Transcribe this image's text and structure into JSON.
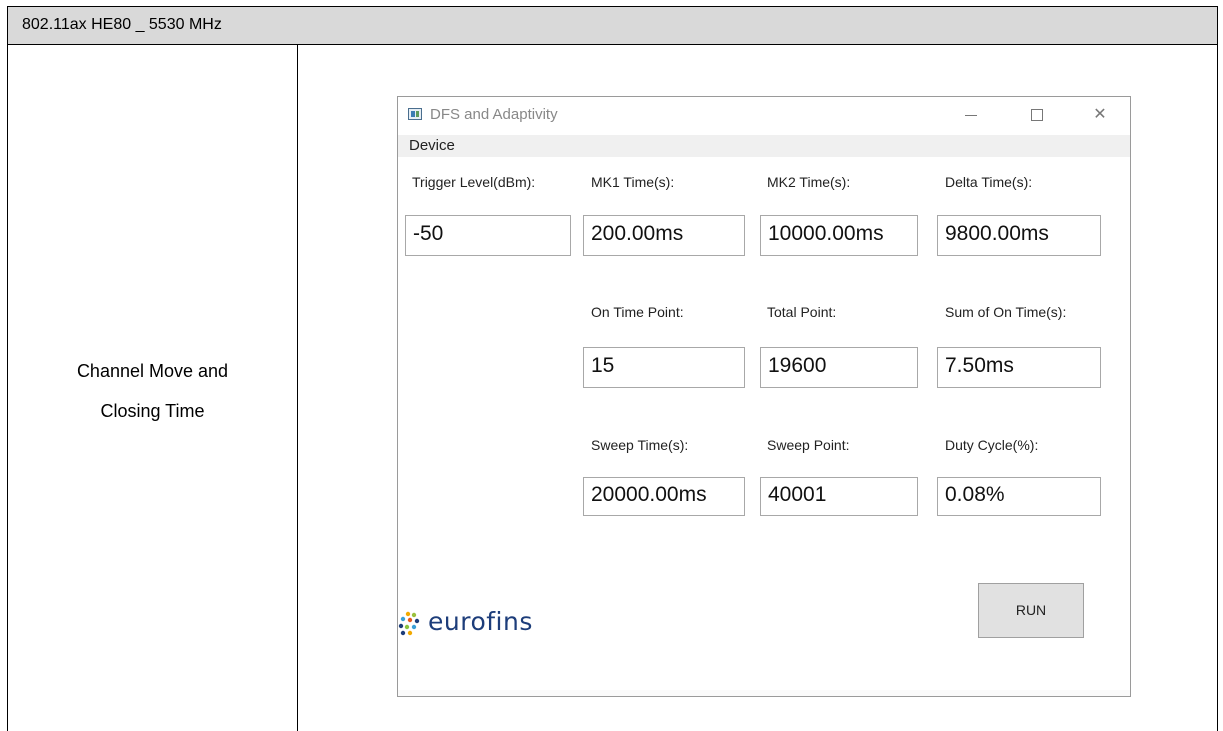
{
  "report": {
    "header": "802.11ax HE80 _ 5530 MHz",
    "row_label_line1": "Channel Move and",
    "row_label_line2": "Closing Time"
  },
  "window": {
    "title": "DFS and Adaptivity",
    "icon": "app-window-icon",
    "controls": {
      "minimize": "—",
      "maximize": "☐",
      "close": "✕"
    }
  },
  "menu": {
    "device": "Device"
  },
  "fields": {
    "trigger_level": {
      "label": "Trigger Level(dBm):",
      "value": "-50"
    },
    "mk1_time": {
      "label": "MK1 Time(s):",
      "value": "200.00ms"
    },
    "mk2_time": {
      "label": "MK2 Time(s):",
      "value": "10000.00ms"
    },
    "delta_time": {
      "label": "Delta Time(s):",
      "value": "9800.00ms"
    },
    "on_time_point": {
      "label": "On Time Point:",
      "value": "15"
    },
    "total_point": {
      "label": "Total Point:",
      "value": "19600"
    },
    "sum_on_time": {
      "label": "Sum of On Time(s):",
      "value": "7.50ms"
    },
    "sweep_time": {
      "label": "Sweep Time(s):",
      "value": "20000.00ms"
    },
    "sweep_point": {
      "label": "Sweep Point:",
      "value": "40001"
    },
    "duty_cycle": {
      "label": "Duty Cycle(%):",
      "value": "0.08%"
    }
  },
  "logo": {
    "text": "eurofins"
  },
  "buttons": {
    "run": "RUN"
  },
  "colors": {
    "header_bg": "#d9d9d9",
    "logo_blue": "#1d3d7a",
    "button_bg": "#e1e1e1"
  }
}
